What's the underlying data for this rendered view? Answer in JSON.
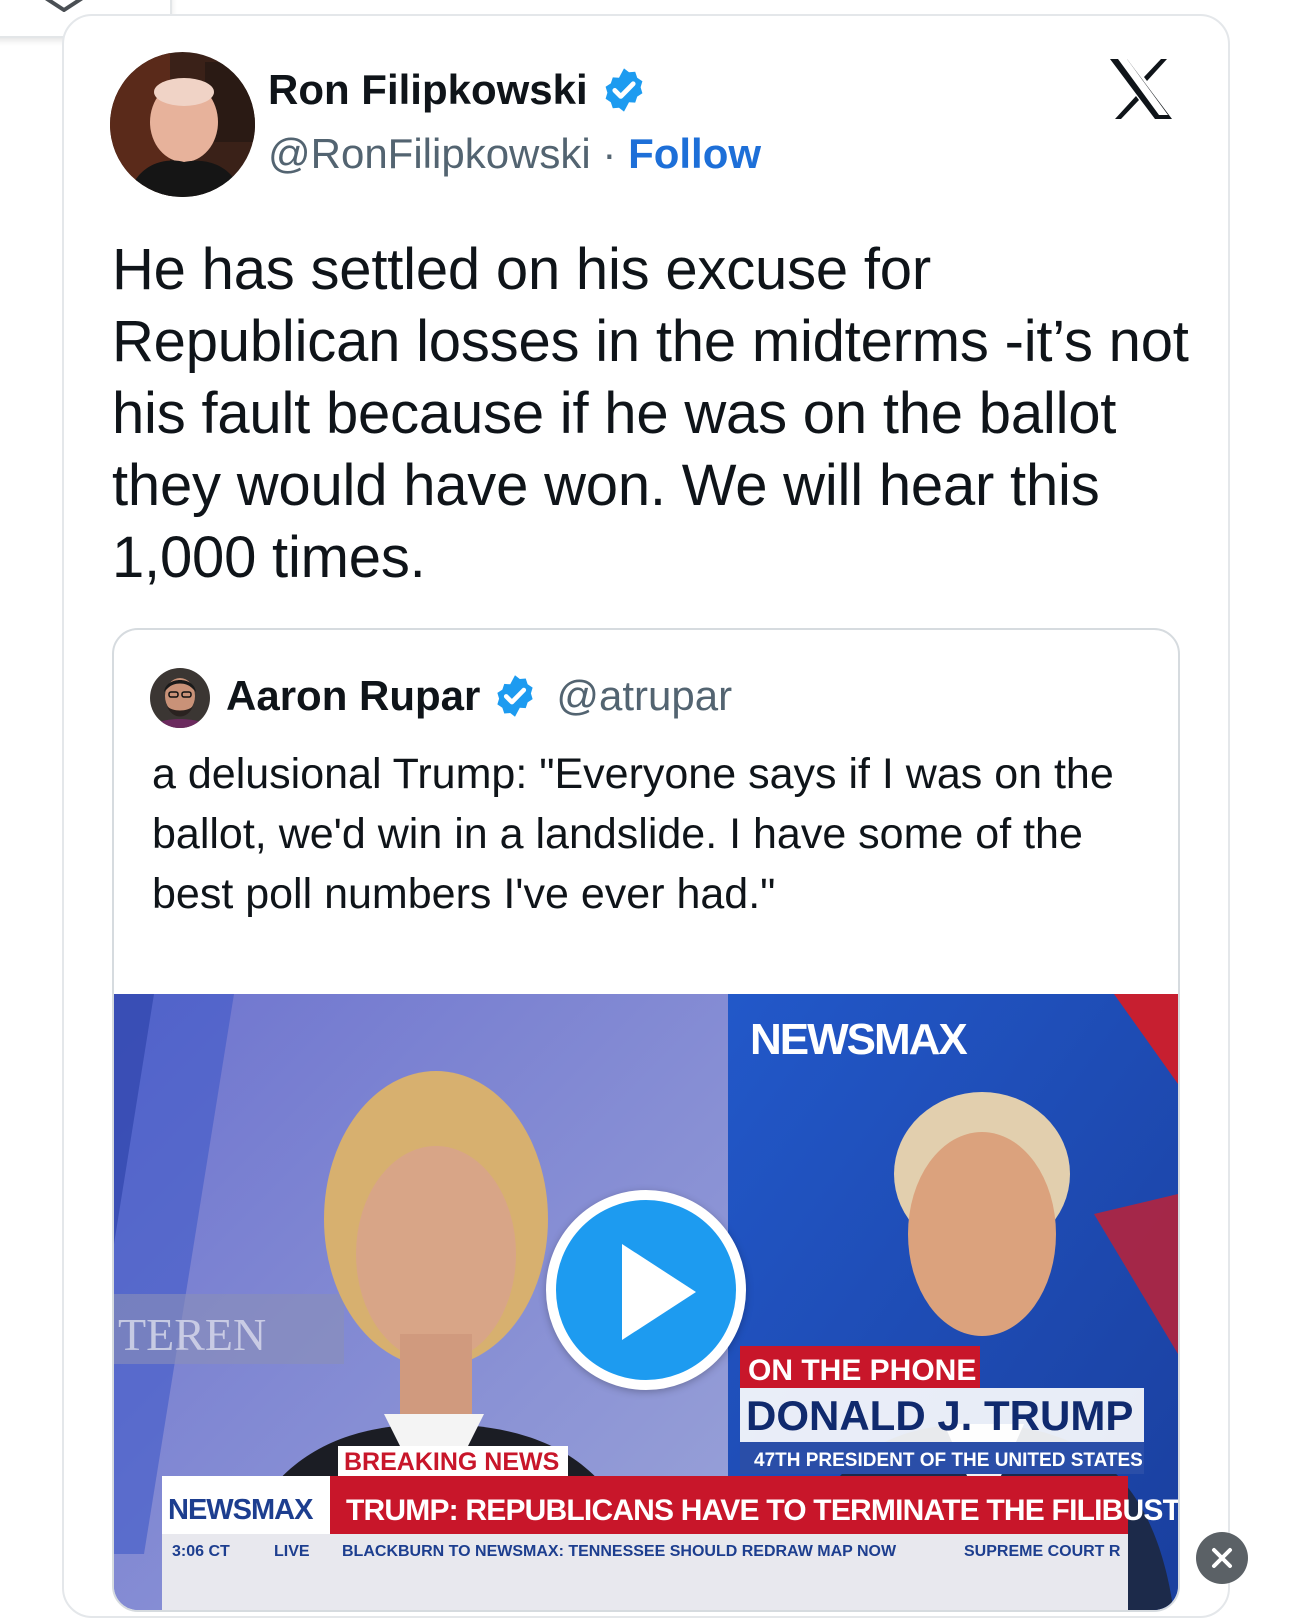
{
  "author": {
    "name": "Ron Filipkowski",
    "handle": "@RonFilipkowski",
    "separator": "·",
    "follow_label": "Follow"
  },
  "tweet": {
    "text": "He has settled on his excuse for Republican losses in the midterms -it’s not his fault because if he was on the ballot they would have won. We will hear this 1,000 times."
  },
  "quoted": {
    "name": "Aaron Rupar",
    "handle": "@atrupar",
    "text": "a delusional Trump: \"Everyone says if I was on the ballot, we'd win in a landslide. I have some of the best poll numbers I've ever had.\""
  },
  "video": {
    "network": "NEWSMAX",
    "background_sign": "TEREN",
    "lower_third_tag": "ON THE PHONE",
    "guest_name": "DONALD J. TRUMP",
    "guest_title": "47TH PRESIDENT OF THE UNITED STATES",
    "breaking_label": "BREAKING NEWS",
    "ticker_logo": "NEWSMAX",
    "headline": "TRUMP: REPUBLICANS HAVE TO TERMINATE THE FILIBUSTER",
    "time": "3:06 CT",
    "live": "LIVE",
    "crawl_1": "BLACKBURN TO NEWSMAX: TENNESSEE SHOULD REDRAW MAP NOW",
    "crawl_2": "SUPREME COURT R"
  },
  "colors": {
    "verified": "#1d9bf0",
    "follow": "#1d6fd8",
    "newsmax_red": "#d0192a",
    "newsmax_blue": "#1d3e8f"
  },
  "icons": [
    "chevron-down-icon",
    "verified-badge-icon",
    "x-logo-icon",
    "play-icon",
    "close-icon"
  ]
}
